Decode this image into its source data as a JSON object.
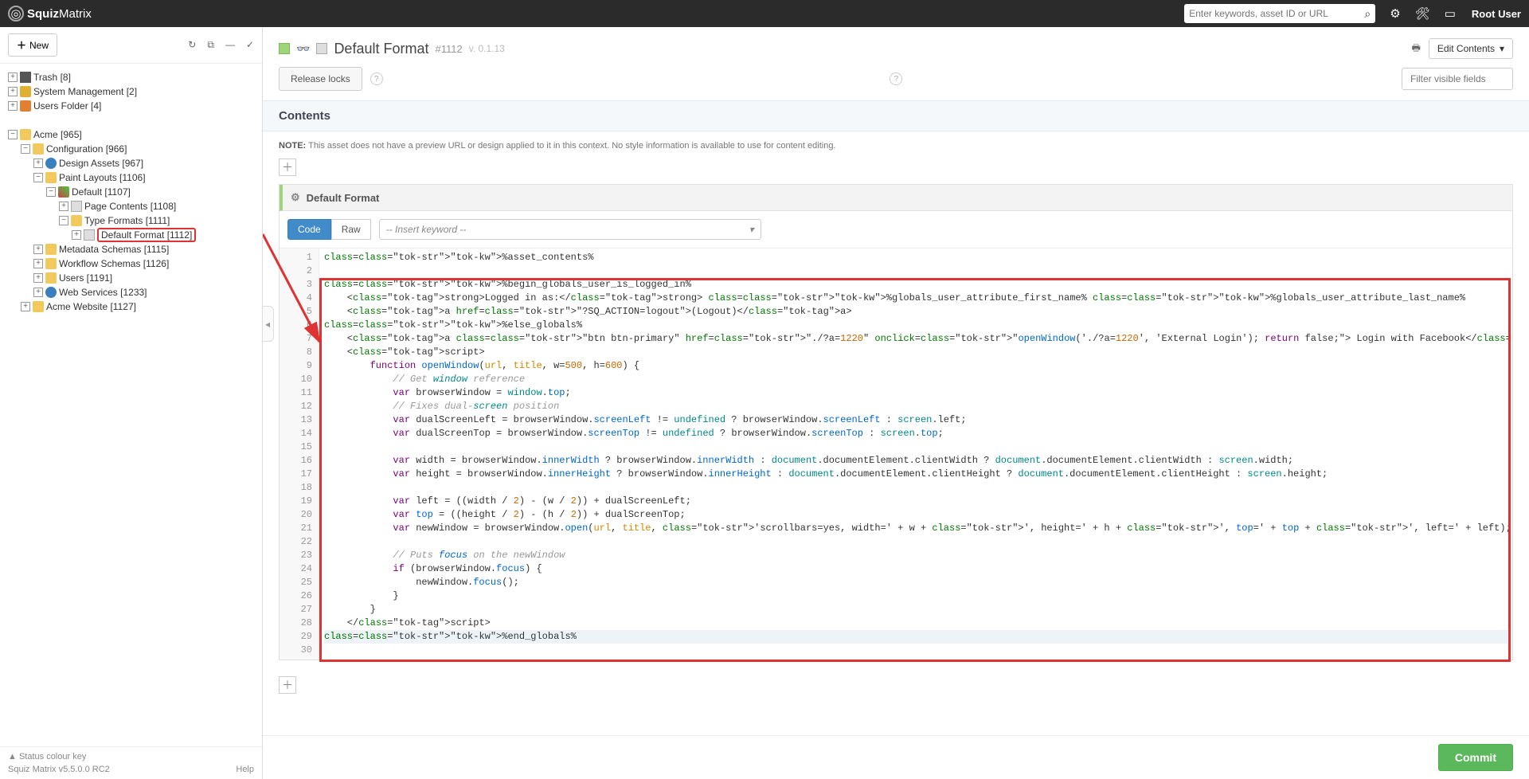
{
  "header": {
    "brand_prefix": "Squiz",
    "brand_suffix": "Matrix",
    "search_placeholder": "Enter keywords, asset ID or URL",
    "user": "Root User"
  },
  "sidebar": {
    "new_btn": "New",
    "tree": [
      {
        "indent": 0,
        "exp": "+",
        "icon": "icn-trash",
        "label": "Trash [8]"
      },
      {
        "indent": 0,
        "exp": "+",
        "icon": "icn-key",
        "label": "System Management [2]"
      },
      {
        "indent": 0,
        "exp": "+",
        "icon": "icn-user",
        "label": "Users Folder [4]"
      },
      {
        "indent": 0,
        "exp": "",
        "icon": "",
        "label": ""
      },
      {
        "indent": 0,
        "exp": "-",
        "icon": "icn-folder",
        "label": "Acme [965]"
      },
      {
        "indent": 1,
        "exp": "-",
        "icon": "icn-folder",
        "label": "Configuration [966]"
      },
      {
        "indent": 2,
        "exp": "+",
        "icon": "icn-globe",
        "label": "Design Assets [967]"
      },
      {
        "indent": 2,
        "exp": "-",
        "icon": "icn-folder",
        "label": "Paint Layouts [1106]"
      },
      {
        "indent": 3,
        "exp": "-",
        "icon": "icn-paint",
        "label": "Default [1107]"
      },
      {
        "indent": 4,
        "exp": "+",
        "icon": "icn-page",
        "label": "Page Contents [1108]"
      },
      {
        "indent": 4,
        "exp": "-",
        "icon": "icn-folder",
        "label": "Type Formats [1111]"
      },
      {
        "indent": 5,
        "exp": "+",
        "icon": "icn-page",
        "label": "Default Format [1112]",
        "selected": true
      },
      {
        "indent": 2,
        "exp": "+",
        "icon": "icn-folder",
        "label": "Metadata Schemas [1115]"
      },
      {
        "indent": 2,
        "exp": "+",
        "icon": "icn-folder",
        "label": "Workflow Schemas [1126]"
      },
      {
        "indent": 2,
        "exp": "+",
        "icon": "icn-folder",
        "label": "Users [1191]"
      },
      {
        "indent": 2,
        "exp": "+",
        "icon": "icn-globe",
        "label": "Web Services [1233]"
      },
      {
        "indent": 1,
        "exp": "+",
        "icon": "icn-folder",
        "label": "Acme Website [1127]"
      }
    ],
    "footer_status": "Status colour key",
    "footer_version": "Squiz Matrix v5.5.0.0 RC2",
    "footer_help": "Help"
  },
  "page": {
    "title": "Default Format",
    "asset_id": "#1112",
    "version": "v. 0.1.13",
    "edit_contents": "Edit Contents",
    "release_locks": "Release locks",
    "filter_placeholder": "Filter visible fields",
    "contents_label": "Contents",
    "note_label": "NOTE:",
    "note_text": "This asset does not have a preview URL or design applied to it in this context. No style information is available to use for content editing.",
    "editor_title": "Default Format",
    "tabs": {
      "code": "Code",
      "raw": "Raw"
    },
    "keyword_placeholder": "-- Insert keyword --",
    "commit": "Commit"
  },
  "code": {
    "line_count": 30,
    "lines": [
      "%asset_contents%",
      "",
      "%begin_globals_user_is_logged_in%",
      "    <strong>Logged in as:</strong> %globals_user_attribute_first_name% %globals_user_attribute_last_name%",
      "    <a href=\"?SQ_ACTION=logout\">(Logout)</a>",
      "%else_globals%",
      "    <a class=\"btn btn-primary\" href=\"./?a=1220\" onclick=\"openWindow('./?a=1220', 'External Login'); return false;\"> Login with Facebook</a>",
      "    <script>",
      "        function openWindow(url, title, w=500, h=600) {",
      "            // Get window reference",
      "            var browserWindow = window.top;",
      "            // Fixes dual-screen position",
      "            var dualScreenLeft = browserWindow.screenLeft != undefined ? browserWindow.screenLeft : screen.left;",
      "            var dualScreenTop = browserWindow.screenTop != undefined ? browserWindow.screenTop : screen.top;",
      "",
      "            var width = browserWindow.innerWidth ? browserWindow.innerWidth : document.documentElement.clientWidth ? document.documentElement.clientWidth : screen.width;",
      "            var height = browserWindow.innerHeight ? browserWindow.innerHeight : document.documentElement.clientHeight ? document.documentElement.clientHeight : screen.height;",
      "",
      "            var left = ((width / 2) - (w / 2)) + dualScreenLeft;",
      "            var top = ((height / 2) - (h / 2)) + dualScreenTop;",
      "            var newWindow = browserWindow.open(url, title, 'scrollbars=yes, width=' + w + ', height=' + h + ', top=' + top + ', left=' + left);",
      "",
      "            // Puts focus on the newWindow",
      "            if (browserWindow.focus) {",
      "                newWindow.focus();",
      "            }",
      "        }",
      "    </script>",
      "%end_globals%",
      ""
    ]
  }
}
